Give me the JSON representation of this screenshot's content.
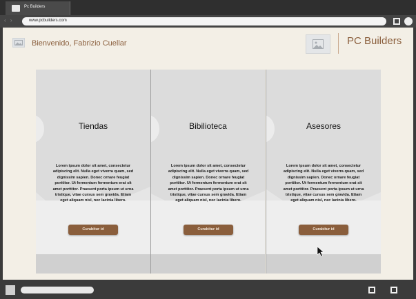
{
  "browser": {
    "tab_title": "Pc Builders",
    "url": "www.pcbuilders.com"
  },
  "header": {
    "greeting": "Bienvenido, Fabrizio Cuellar",
    "avatar_icon": "image-icon",
    "logo_icon": "image-icon",
    "brand": "PC Builders"
  },
  "cards": [
    {
      "title": "Tiendas",
      "text": "Lorem ipsum dolor sit amet, consectetur adipiscing elit. Nulla eget viverra quam, sed dignissim sapien. Donec ornare feugiat porttitor. Ut fermentum fermentum erat sit amet porttitor. Praesent porta ipsum ut urna tristique, vitae cursus sem gravida. Etiam eget aliquam nisl, nec lacinia libero.",
      "button": "Curabitur id"
    },
    {
      "title": "Bibilioteca",
      "text": "Lorem ipsum dolor sit amet, consectetur adipiscing elit. Nulla eget viverra quam, sed dignissim sapien. Donec ornare feugiat porttitor. Ut fermentum fermentum erat sit amet porttitor. Praesent porta ipsum ut urna tristique, vitae cursus sem gravida. Etiam eget aliquam nisl, nec lacinia libero.",
      "button": "Curabitur id"
    },
    {
      "title": "Asesores",
      "text": "Lorem ipsum dolor sit amet, consectetur adipiscing elit. Nulla eget viverra quam, sed dignissim sapien. Donec ornare feugiat porttitor. Ut fermentum fermentum erat sit amet porttitor. Praesent porta ipsum ut urna tristique, vitae cursus sem gravida. Etiam eget aliquam nisl, nec lacinia libero.",
      "button": "Curabitur id"
    }
  ],
  "colors": {
    "accent": "#8a5e3c",
    "page_bg": "#f3efe6",
    "card_bg": "#dcdcdc",
    "chrome": "#3b3b3b"
  }
}
